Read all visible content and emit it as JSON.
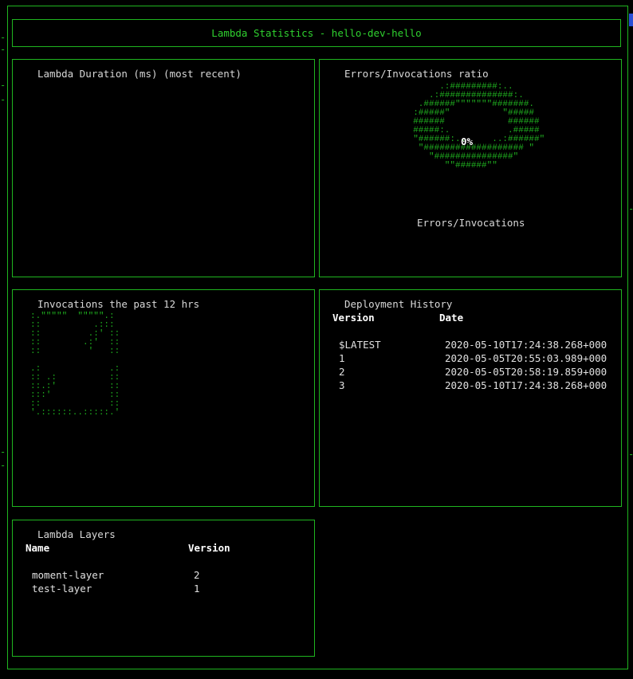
{
  "header": {
    "title": "Lambda Statistics - hello-dev-hello"
  },
  "duration": {
    "title": "Lambda Duration (ms) (most recent)"
  },
  "errors": {
    "title": "Errors/Invocations ratio",
    "percent": "0%",
    "label": "Errors/Invocations"
  },
  "invocations": {
    "title": "Invocations the past 12 hrs"
  },
  "deployments": {
    "title": "Deployment History",
    "columns": [
      "Version",
      "Date"
    ],
    "rows": [
      {
        "version": "$LATEST",
        "date": "2020-05-10T17:24:38.268+000"
      },
      {
        "version": "1",
        "date": "2020-05-05T20:55:03.989+000"
      },
      {
        "version": "2",
        "date": "2020-05-05T20:58:19.859+000"
      },
      {
        "version": "3",
        "date": "2020-05-10T17:24:38.268+000"
      }
    ]
  },
  "layers": {
    "title": "Lambda Layers",
    "columns": [
      "Name",
      "Version"
    ],
    "rows": [
      {
        "name": "moment-layer",
        "version": "2"
      },
      {
        "name": "test-layer",
        "version": "1"
      }
    ]
  },
  "colors": {
    "border": "#1fb51f",
    "accent": "#2fd12f"
  }
}
